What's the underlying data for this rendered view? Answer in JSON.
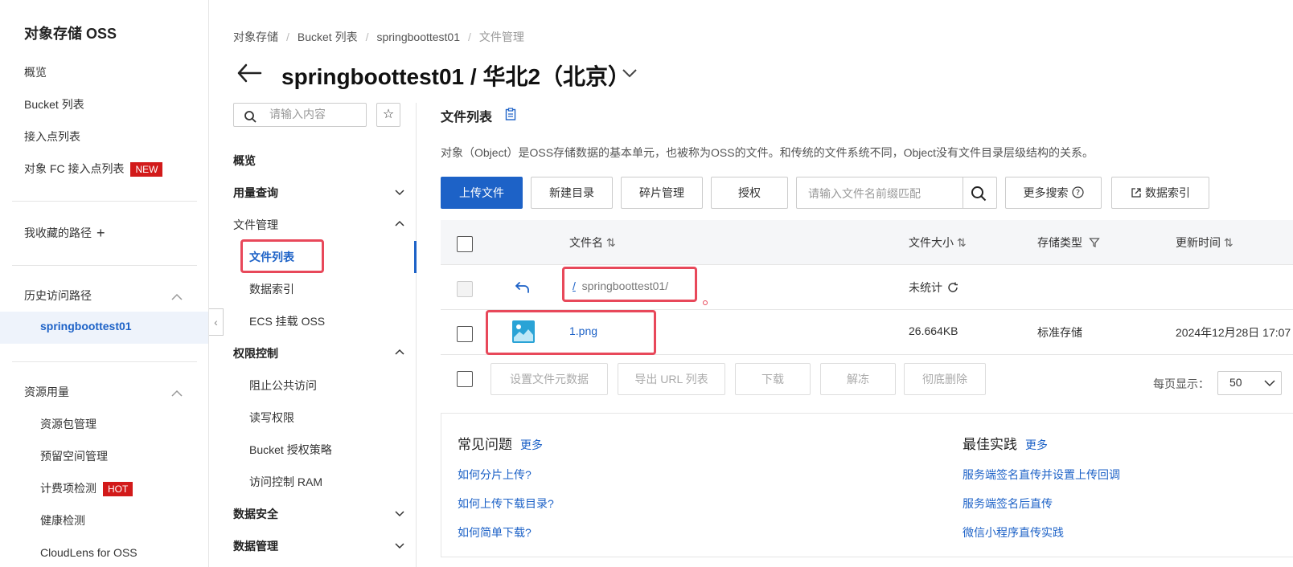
{
  "sidebar": {
    "title": "对象存储 OSS",
    "items": [
      {
        "label": "概览"
      },
      {
        "label": "Bucket 列表"
      },
      {
        "label": "接入点列表"
      },
      {
        "label": "对象 FC 接入点列表",
        "badge": "NEW"
      }
    ],
    "favorites_label": "我收藏的路径",
    "history_label": "历史访问路径",
    "history_item": "springboottest01",
    "resource_label": "资源用量",
    "resource_items": [
      {
        "label": "资源包管理"
      },
      {
        "label": "预留空间管理"
      },
      {
        "label": "计费项检测",
        "badge": "HOT"
      },
      {
        "label": "健康检测"
      },
      {
        "label": "CloudLens for OSS"
      }
    ]
  },
  "breadcrumb": [
    "对象存储",
    "Bucket 列表",
    "springboottest01",
    "文件管理"
  ],
  "page_title": "springboottest01 / 华北2（北京）",
  "mid_nav": {
    "search_placeholder": "请输入内容",
    "groups": [
      {
        "label": "概览"
      },
      {
        "label": "用量查询"
      },
      {
        "label": "文件管理"
      },
      {
        "label": "权限控制"
      },
      {
        "label": "数据安全"
      },
      {
        "label": "数据管理"
      }
    ],
    "file_items": [
      "文件列表",
      "数据索引",
      "ECS 挂载 OSS"
    ],
    "perm_items": [
      "阻止公共访问",
      "读写权限",
      "Bucket 授权策略",
      "访问控制 RAM"
    ]
  },
  "main": {
    "title": "文件列表",
    "description": "对象（Object）是OSS存储数据的基本单元，也被称为OSS的文件。和传统的文件系统不同，Object没有文件目录层级结构的关系。",
    "toolbar": {
      "upload": "上传文件",
      "new_dir": "新建目录",
      "fragments": "碎片管理",
      "authorize": "授权",
      "search_placeholder": "请输入文件名前缀匹配",
      "more_search": "更多搜索",
      "data_index": "数据索引"
    },
    "table": {
      "headers": {
        "name": "文件名",
        "size": "文件大小",
        "storage": "存储类型",
        "updated": "更新时间"
      },
      "parent_row": {
        "slash": "/",
        "path": "springboottest01/",
        "size": "未统计"
      },
      "rows": [
        {
          "name": "1.png",
          "size": "26.664KB",
          "storage": "标准存储",
          "updated": "2024年12月28日 17:07"
        }
      ]
    },
    "bulk_actions": [
      "设置文件元数据",
      "导出 URL 列表",
      "下载",
      "解冻",
      "彻底删除"
    ],
    "per_page_label": "每页显示：",
    "per_page_value": "50"
  },
  "faq": {
    "left_title": "常见问题",
    "left_more": "更多",
    "left_links": [
      "如何分片上传?",
      "如何上传下载目录?",
      "如何简单下载?"
    ],
    "right_title": "最佳实践",
    "right_more": "更多",
    "right_links": [
      "服务端签名直传并设置上传回调",
      "服务端签名后直传",
      "微信小程序直传实践"
    ]
  }
}
